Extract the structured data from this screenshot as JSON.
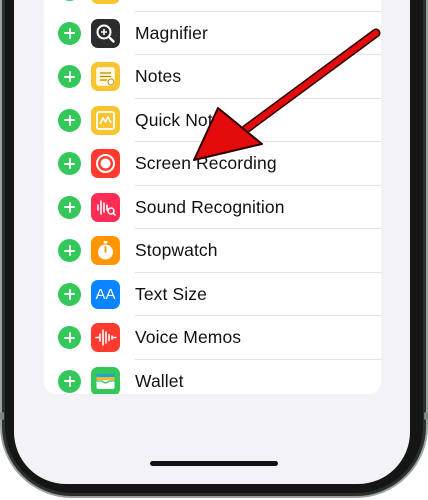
{
  "controls": {
    "add_action": "add",
    "items": [
      {
        "label": "",
        "icon": "partial-yellow-icon",
        "color": "#f7c531"
      },
      {
        "label": "Magnifier",
        "icon": "magnifier-icon",
        "color": "#2c2c2e"
      },
      {
        "label": "Notes",
        "icon": "notes-icon",
        "color": "#f8c531"
      },
      {
        "label": "Quick Note",
        "icon": "quick-note-icon",
        "color": "#f8c531"
      },
      {
        "label": "Screen Recording",
        "icon": "screen-recording-icon",
        "color": "#ff3b30"
      },
      {
        "label": "Sound Recognition",
        "icon": "sound-recognition-icon",
        "color": "#ff2d55"
      },
      {
        "label": "Stopwatch",
        "icon": "stopwatch-icon",
        "color": "#ff9500"
      },
      {
        "label": "Text Size",
        "icon": "text-size-icon",
        "color": "#0a84ff"
      },
      {
        "label": "Voice Memos",
        "icon": "voice-memos-icon",
        "color": "#ff3b30"
      },
      {
        "label": "Wallet",
        "icon": "wallet-icon",
        "color": "#34c759"
      }
    ]
  },
  "text_size_glyph": "AA",
  "annotation": {
    "arrow_color": "#e30b0b",
    "target": "Screen Recording"
  },
  "colors": {
    "add_button": "#34c759",
    "screen_bg": "#f2f2f7",
    "card_bg": "#ffffff"
  }
}
